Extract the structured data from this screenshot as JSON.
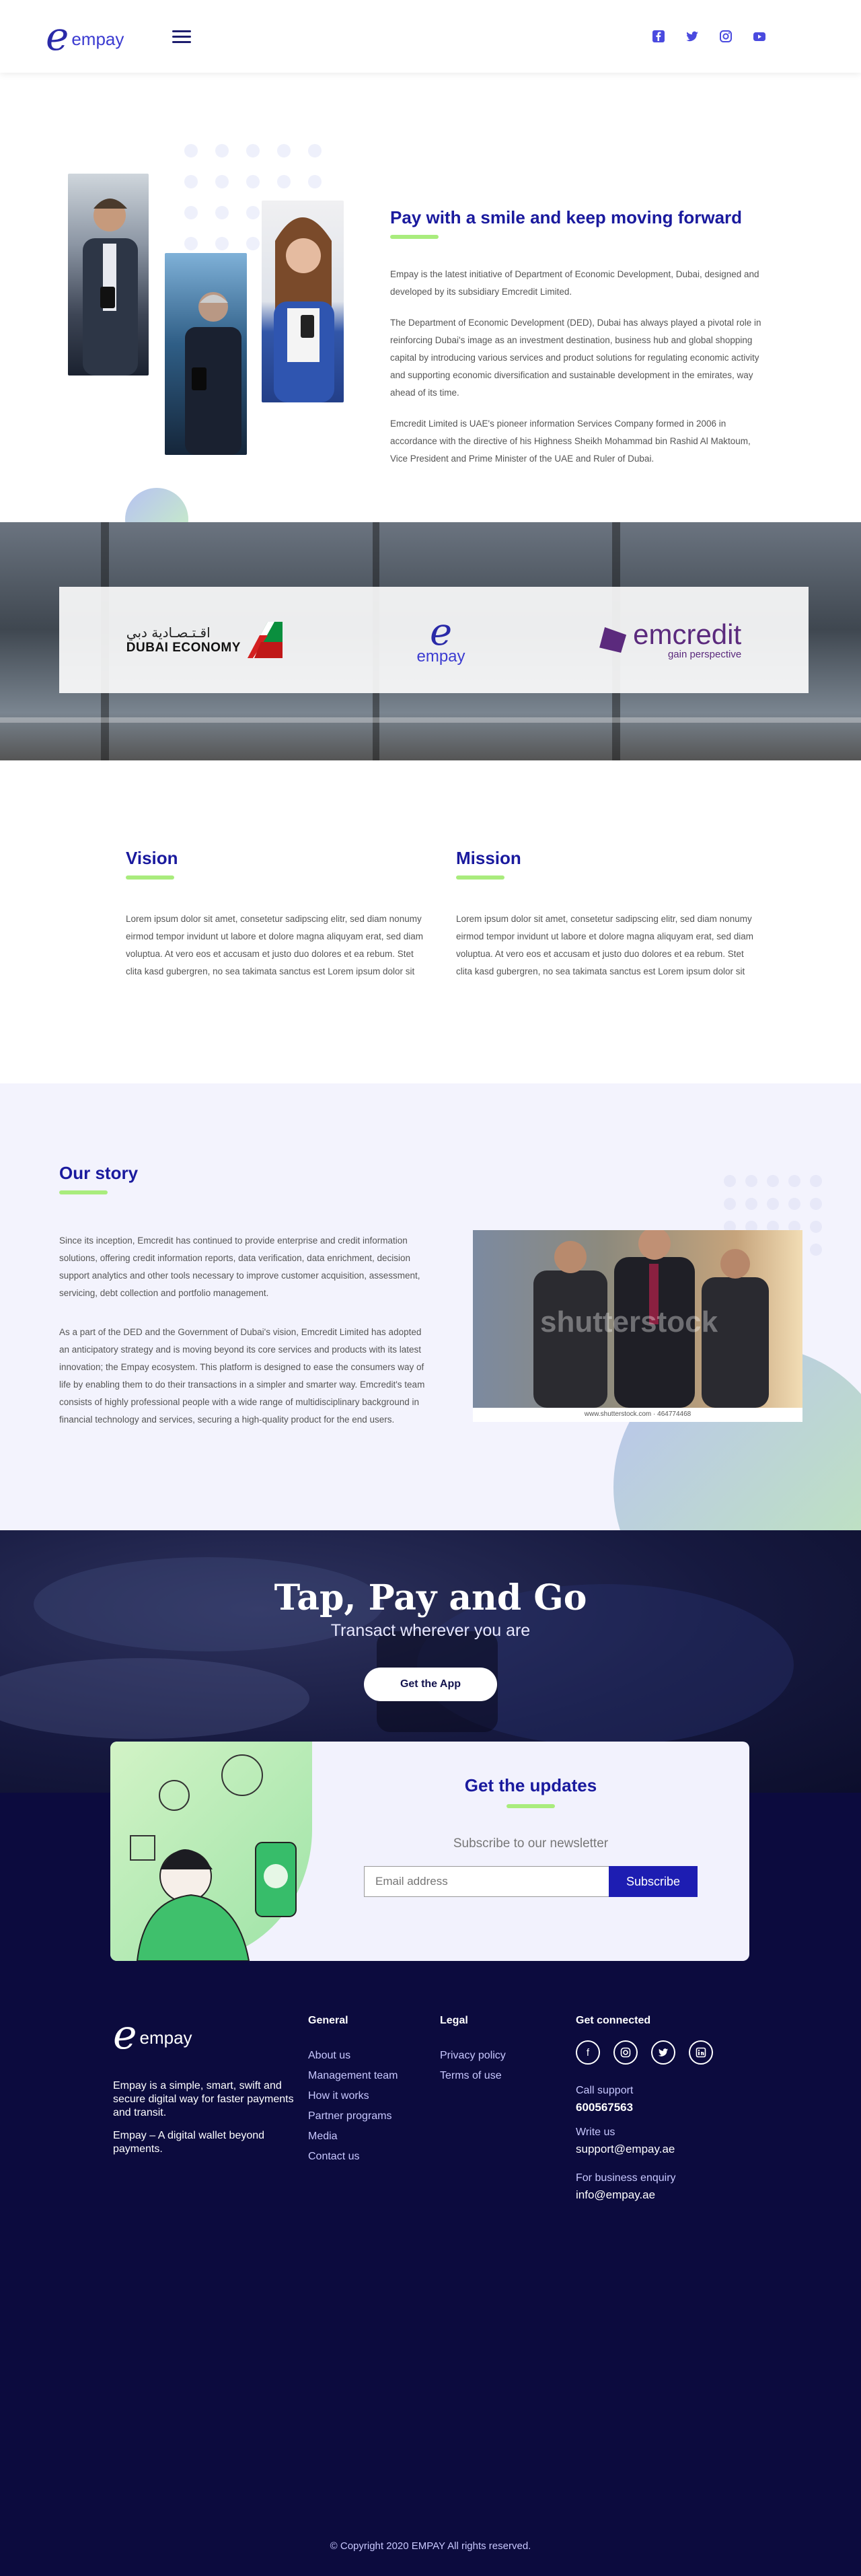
{
  "header": {
    "logo_mark": "e",
    "logo_text": "empay",
    "socials": [
      "facebook-icon",
      "twitter-icon",
      "instagram-icon",
      "youtube-icon"
    ]
  },
  "about": {
    "title": "Pay with a smile and keep moving forward",
    "paragraphs": [
      "Empay is the latest initiative of Department of Economic Development, Dubai, designed and developed by its subsidiary Emcredit Limited.",
      "The Department of Economic Development (DED), Dubai has always played a pivotal role in reinforcing Dubai's image as an investment destination, business hub and global shopping capital by introducing various services and product solutions for regulating economic activity and supporting economic diversification and sustainable development in the emirates, way ahead of its time.",
      "Emcredit Limited is UAE's pioneer information Services Company formed in 2006 in accordance with the directive of his Highness Sheikh Mohammad bin Rashid Al Maktoum, Vice President and Prime Minister of the UAE and Ruler of Dubai."
    ]
  },
  "partners": {
    "dubai_arabic": "اقـتـصـادية دبي",
    "dubai_english": "DUBAI ECONOMY",
    "empay_mark": "e",
    "empay_text": "empay",
    "emcredit_name": "emcredit",
    "emcredit_tag": "gain perspective"
  },
  "vision": {
    "title": "Vision",
    "text": "Lorem ipsum dolor sit amet, consetetur sadipscing elitr, sed diam nonumy eirmod tempor invidunt ut labore et dolore magna aliquyam erat, sed diam voluptua. At vero eos et accusam et justo duo dolores et ea rebum. Stet clita kasd gubergren, no sea takimata sanctus est Lorem ipsum dolor sit"
  },
  "mission": {
    "title": "Mission",
    "text": "Lorem ipsum dolor sit amet, consetetur sadipscing elitr, sed diam nonumy eirmod tempor invidunt ut labore et dolore magna aliquyam erat, sed diam voluptua. At vero eos et accusam et justo duo dolores et ea rebum. Stet clita kasd gubergren, no sea takimata sanctus est Lorem ipsum dolor sit"
  },
  "story": {
    "title": "Our story",
    "paragraphs": [
      "Since its inception, Emcredit has continued to provide enterprise and credit information solutions, offering credit information reports, data verification, data enrichment, decision support analytics and other tools necessary to improve customer acquisition, assessment, servicing, debt collection and portfolio management.",
      "As a part of the DED and the Government of Dubai's vision, Emcredit Limited has adopted an anticipatory strategy and is moving beyond its core services and products with its latest innovation; the Empay ecosystem. This platform is designed to ease the consumers way of life by enabling them to do their transactions in a simpler and smarter way. Emcredit's team consists of highly professional people with a wide range of multidisciplinary background in financial technology and services, securing a high-quality product for the end users."
    ],
    "image_caption": "www.shutterstock.com · 464774468",
    "watermark": "shutterstock"
  },
  "tap": {
    "title": "Tap, Pay and Go",
    "subtitle": "Transact wherever you are",
    "button": "Get the App"
  },
  "newsletter": {
    "title": "Get the updates",
    "subtitle": "Subscribe to our newsletter",
    "placeholder": "Email address",
    "button": "Subscribe"
  },
  "footer": {
    "logo_mark": "e",
    "logo_text": "empay",
    "desc1": "Empay is a simple, smart, swift and secure digital way for faster payments and transit.",
    "desc2": "Empay – A digital wallet beyond payments.",
    "general_title": "General",
    "general_links": [
      "About us",
      "Management team",
      "How it works",
      "Partner programs",
      "Media",
      "Contact us"
    ],
    "legal_title": "Legal",
    "legal_links": [
      "Privacy policy",
      "Terms of use"
    ],
    "connect_title": "Get connected",
    "call_label": "Call support",
    "call_value": "600567563",
    "write_label": "Write us",
    "write_value": "support@empay.ae",
    "business_label": "For business enquiry",
    "business_value": "info@empay.ae",
    "copyright": "© Copyright 2020 EMPAY All rights reserved."
  }
}
